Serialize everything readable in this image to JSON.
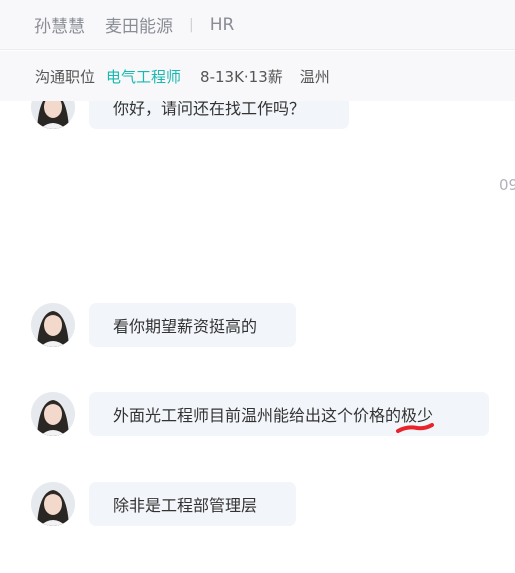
{
  "header": {
    "name": "孙慧慧",
    "company": "麦田能源",
    "divider": "|",
    "role": "HR"
  },
  "subbar": {
    "label": "沟通职位",
    "job_title": "电气工程师",
    "salary": "8-13K·13薪",
    "city": "温州"
  },
  "messages": [
    {
      "text": "你好，请问还在找工作吗？"
    },
    {
      "text": "看你期望薪资挺高的"
    },
    {
      "text_before": "外面光工程师目前温州能给出这个价格的",
      "text_highlight": "极少"
    },
    {
      "text": "除非是工程部管理层"
    }
  ],
  "timestamp": "09",
  "colors": {
    "accent": "#17b8b0",
    "bubble_bg": "#f2f5f9",
    "annotation": "#e8242a"
  }
}
